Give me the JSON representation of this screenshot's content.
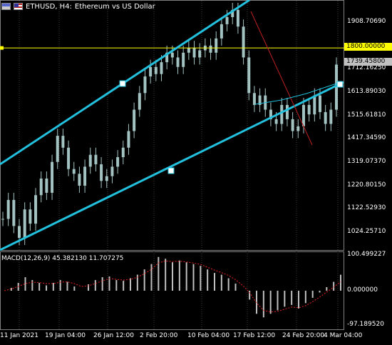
{
  "window": {
    "symbol": "ETHUSD, H4:",
    "description": "Ethereum vs US Dollar"
  },
  "price_axis": {
    "ticks": [
      "1908.70690",
      "1712.16250",
      "1613.89030",
      "1515.61810",
      "1417.34590",
      "1319.07370",
      "1220.80150",
      "1122.52930",
      "1024.25710"
    ],
    "level_label": "1800.00000",
    "current_label": "1739.45800"
  },
  "macd_axis": {
    "ticks": [
      "100.499227",
      "0.000000",
      "-97.189520"
    ]
  },
  "macd": {
    "label": "MACD(12,26,9) 45.382130 11.707275"
  },
  "time_axis": {
    "ticks": [
      "11 Jan 2021",
      "19 Jan 04:00",
      "26 Jan 12:00",
      "2 Feb 20:00",
      "10 Feb 04:00",
      "17 Feb 12:00",
      "24 Feb 20:00",
      "4 Mar 04:00"
    ]
  },
  "colors": {
    "background": "#000000",
    "bar": "#a3c2c2",
    "channel": "#22c0dc",
    "level": "#ffff00",
    "trendline": "#c02020",
    "grid": "#404040",
    "macd_hist": "#c0c0c0",
    "macd_signal": "#e02020"
  },
  "chart_data": {
    "type": "candlestick",
    "symbol": "ETHUSD",
    "timeframe": "H4",
    "y_range": [
      960,
      2010
    ],
    "close": [
      1080,
      1160,
      1050,
      1000,
      1120,
      1060,
      1180,
      1250,
      1190,
      1320,
      1430,
      1380,
      1290,
      1270,
      1220,
      1300,
      1350,
      1310,
      1240,
      1260,
      1300,
      1340,
      1380,
      1450,
      1540,
      1610,
      1680,
      1720,
      1690,
      1740,
      1780,
      1760,
      1720,
      1780,
      1800,
      1760,
      1790,
      1810,
      1780,
      1840,
      1900,
      1930,
      1960,
      1890,
      1760,
      1610,
      1560,
      1600,
      1540,
      1500,
      1480,
      1560,
      1500,
      1450,
      1470,
      1560,
      1520,
      1600,
      1530,
      1480,
      1540,
      1730
    ],
    "macd_values": [
      0,
      8,
      22,
      38,
      30,
      22,
      15,
      22,
      30,
      25,
      12,
      0,
      18,
      30,
      38,
      40,
      30,
      28,
      35,
      45,
      60,
      75,
      95,
      90,
      80,
      85,
      80,
      75,
      70,
      60,
      50,
      45,
      35,
      20,
      0,
      -25,
      -65,
      -75,
      -65,
      -55,
      -45,
      -40,
      -50,
      -35,
      -20,
      -5,
      10,
      25,
      45
    ],
    "macd_signal": [
      0,
      5,
      12,
      20,
      24,
      23,
      20,
      20,
      24,
      25,
      20,
      12,
      14,
      20,
      28,
      34,
      32,
      30,
      32,
      38,
      48,
      60,
      78,
      84,
      82,
      83,
      81,
      78,
      74,
      66,
      58,
      51,
      43,
      31,
      15,
      -5,
      -35,
      -55,
      -60,
      -58,
      -52,
      -46,
      -48,
      -42,
      -31,
      -18,
      -4,
      10,
      25
    ],
    "macd_range": [
      -97.18952,
      100.499227
    ],
    "horizontal_level": 1800.0,
    "current_price": 1739.458
  }
}
